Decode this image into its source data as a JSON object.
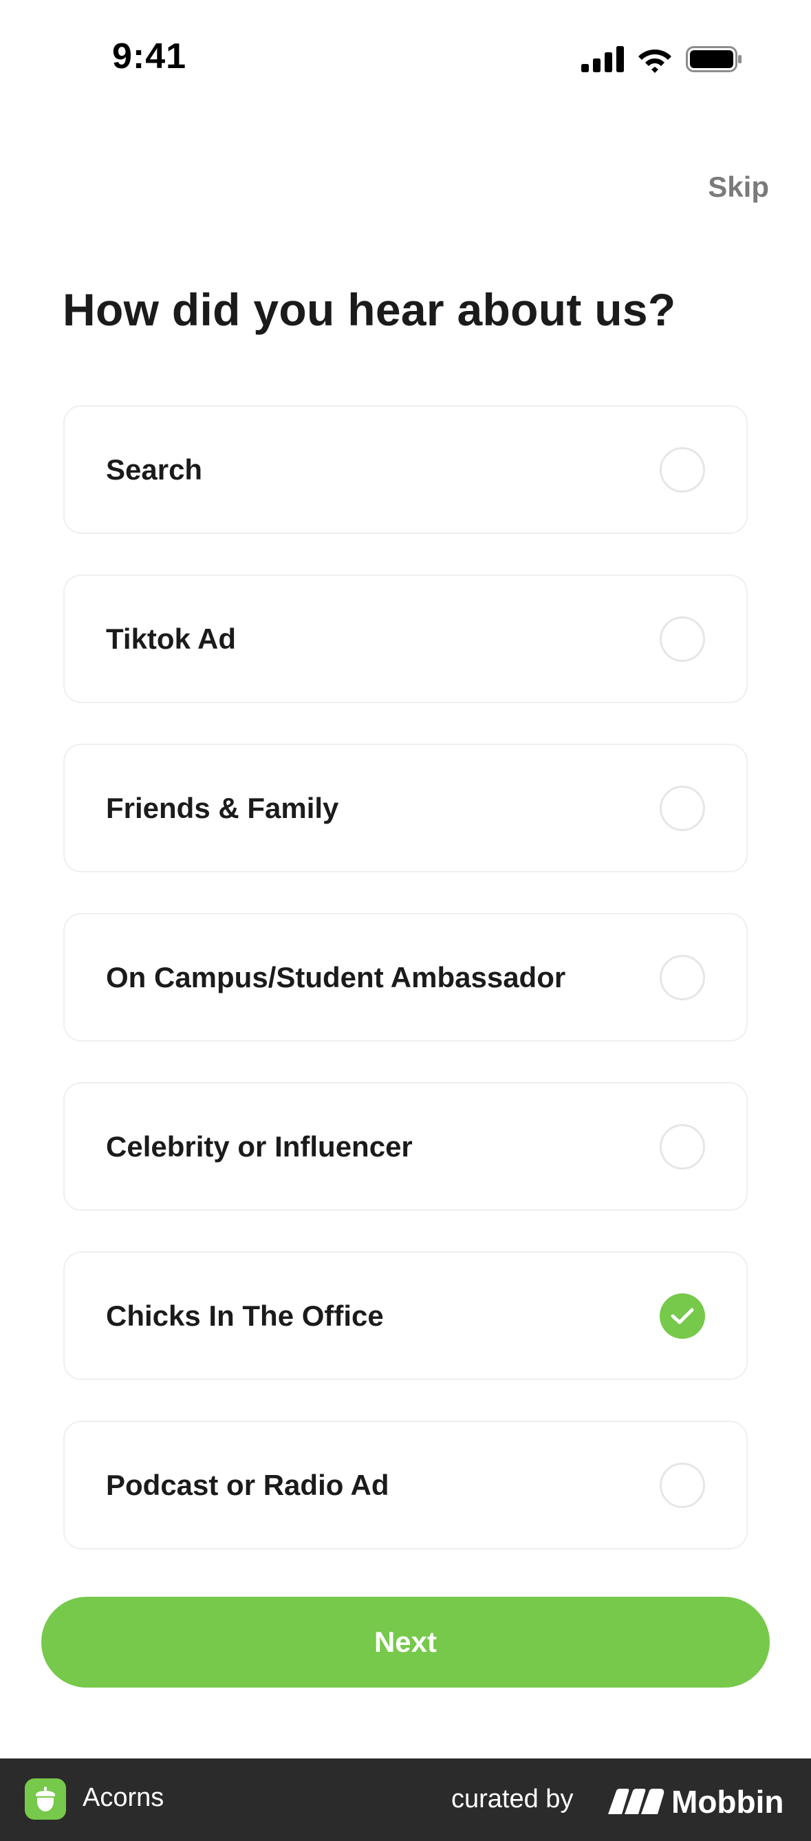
{
  "status_bar": {
    "time": "9:41"
  },
  "header": {
    "skip_label": "Skip"
  },
  "page": {
    "title": "How did you hear about us?"
  },
  "options": [
    {
      "label": "Search",
      "selected": false
    },
    {
      "label": "Tiktok Ad",
      "selected": false
    },
    {
      "label": "Friends & Family",
      "selected": false
    },
    {
      "label": "On Campus/Student Ambassador",
      "selected": false
    },
    {
      "label": "Celebrity or Influencer",
      "selected": false
    },
    {
      "label": "Chicks In The Office",
      "selected": true
    },
    {
      "label": "Podcast or Radio Ad",
      "selected": false
    }
  ],
  "footer": {
    "next_label": "Next"
  },
  "branding": {
    "app_name": "Acorns",
    "curated_by": "curated by",
    "curator": "Mobbin"
  },
  "colors": {
    "accent": "#76c94a",
    "text": "#1b1b1b",
    "muted": "#7a7a7a",
    "border": "#efefef",
    "brand_bar": "#2b2b2b"
  },
  "icons": {
    "signal": "cellular-signal-icon",
    "wifi": "wifi-icon",
    "battery": "battery-icon",
    "check": "checkmark-icon",
    "app_logo": "acorn-icon",
    "curator_logo": "mobbin-logo-icon"
  }
}
